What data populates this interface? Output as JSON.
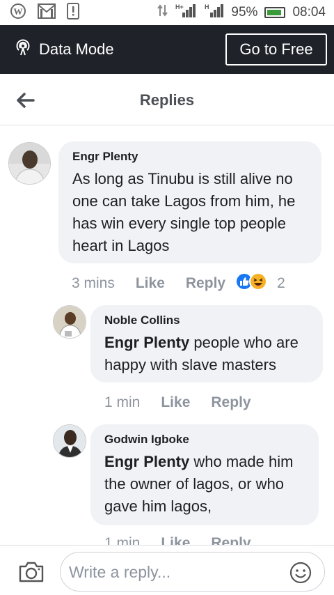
{
  "status_bar": {
    "battery": "95%",
    "time": "08:04",
    "network_1": "H+",
    "network_2": "H",
    "battery_color": "#3a9b3a"
  },
  "data_bar": {
    "label": "Data Mode",
    "button": "Go to Free",
    "background": "#1f2229"
  },
  "header": {
    "title": "Replies"
  },
  "comments": [
    {
      "author": "Engr Plenty",
      "text": "As long as Tinubu is still alive no one can take Lagos from him, he has win every single top people heart in Lagos",
      "time": "3 mins",
      "like": "Like",
      "reply": "Reply",
      "reaction_count": "2",
      "reactions": [
        "like-reaction-icon",
        "haha-reaction-icon"
      ]
    },
    {
      "author": "Noble Collins",
      "mention": "Engr Plenty",
      "text": " people who are happy with slave masters",
      "time": "1 min",
      "like": "Like",
      "reply": "Reply"
    },
    {
      "author": "Godwin Igboke",
      "mention": "Engr Plenty",
      "text": " who made him the owner of lagos, or who gave him lagos,",
      "time": "1 min",
      "like": "Like",
      "reply": "Reply"
    }
  ],
  "composer": {
    "placeholder": "Write a reply..."
  }
}
